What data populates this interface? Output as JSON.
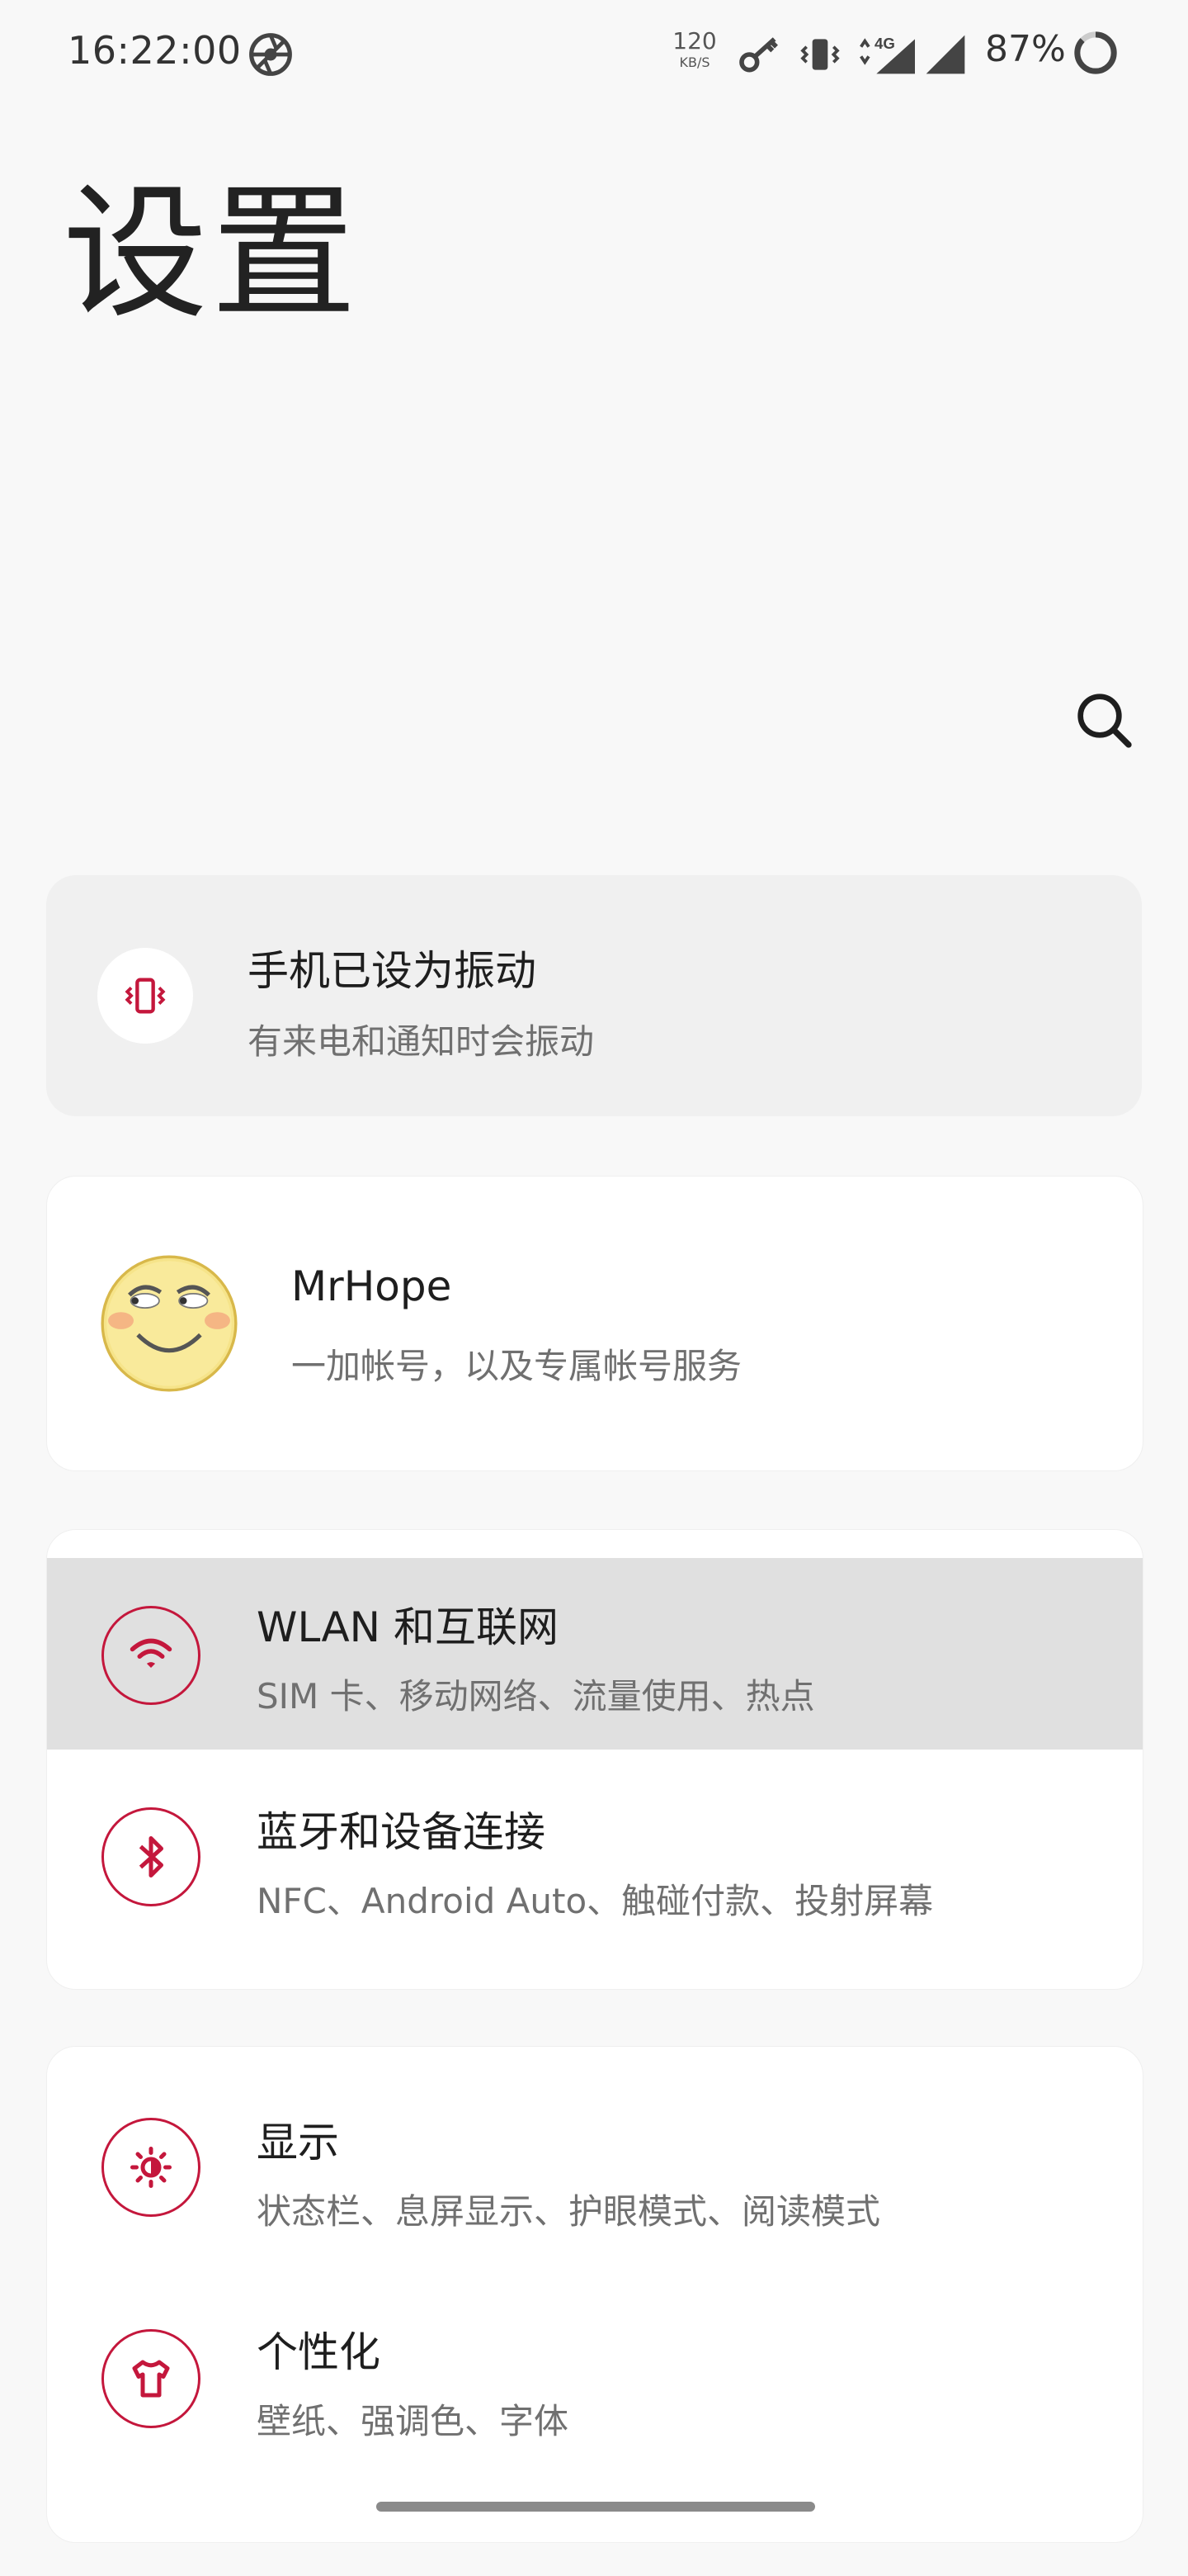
{
  "status_bar": {
    "time": "16:22:00",
    "net_speed_value": "120",
    "net_speed_unit": "KB/S",
    "network_type": "4G",
    "battery_percent": "87%",
    "icons": [
      "aperture-icon",
      "key-icon",
      "vibrate-icon",
      "data-arrows-icon",
      "signal-icon",
      "signal-icon",
      "battery-ring-icon"
    ]
  },
  "header": {
    "title": "设置"
  },
  "vibration_card": {
    "title": "手机已设为振动",
    "subtitle": "有来电和通知时会振动"
  },
  "account_card": {
    "name": "MrHope",
    "subtitle": "一加帐号，以及专属帐号服务"
  },
  "settings_group_1": [
    {
      "title": "WLAN 和互联网",
      "subtitle": "SIM 卡、移动网络、流量使用、热点",
      "icon": "wifi-icon",
      "highlighted": true
    },
    {
      "title": "蓝牙和设备连接",
      "subtitle": "NFC、Android Auto、触碰付款、投射屏幕",
      "icon": "bluetooth-icon",
      "highlighted": false
    }
  ],
  "settings_group_2": [
    {
      "title": "显示",
      "subtitle": "状态栏、息屏显示、护眼模式、阅读模式",
      "icon": "brightness-icon"
    },
    {
      "title": "个性化",
      "subtitle": "壁纸、强调色、字体",
      "icon": "tshirt-icon"
    }
  ],
  "colors": {
    "accent": "#c4173c",
    "highlight": "#e0e0e0",
    "background": "#f8f8f8"
  }
}
